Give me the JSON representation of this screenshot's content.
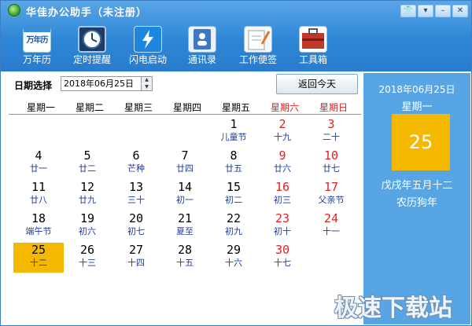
{
  "window": {
    "title": "华佳办公助手（未注册）",
    "controls": [
      "shirt-icon",
      "menu-icon",
      "minimize-icon",
      "close-icon"
    ]
  },
  "toolbar": {
    "items": [
      {
        "label": "万年历",
        "icon": "calendar-icon",
        "icon_text": "万年历"
      },
      {
        "label": "定时提醒",
        "icon": "clock-icon"
      },
      {
        "label": "闪电启动",
        "icon": "lightning-icon"
      },
      {
        "label": "通讯录",
        "icon": "contacts-icon"
      },
      {
        "label": "工作便签",
        "icon": "notes-icon"
      },
      {
        "label": "工具箱",
        "icon": "toolbox-icon"
      }
    ]
  },
  "datebar": {
    "label": "日期选择",
    "value": "2018年06月25日",
    "today_button": "返回今天"
  },
  "weekdays": [
    "星期一",
    "星期二",
    "星期三",
    "星期四",
    "星期五",
    "星期六",
    "星期日"
  ],
  "calendar": {
    "weeks": [
      [
        null,
        null,
        null,
        null,
        {
          "d": "1",
          "l": "儿童节"
        },
        {
          "d": "2",
          "l": "十九"
        },
        {
          "d": "3",
          "l": "二十"
        }
      ],
      [
        {
          "d": "4",
          "l": "廿一"
        },
        {
          "d": "5",
          "l": "廿二"
        },
        {
          "d": "6",
          "l": "芒种"
        },
        {
          "d": "7",
          "l": "廿四"
        },
        {
          "d": "8",
          "l": "廿五"
        },
        {
          "d": "9",
          "l": "廿六"
        },
        {
          "d": "10",
          "l": "廿七"
        }
      ],
      [
        {
          "d": "11",
          "l": "廿八"
        },
        {
          "d": "12",
          "l": "廿九"
        },
        {
          "d": "13",
          "l": "三十"
        },
        {
          "d": "14",
          "l": "初一"
        },
        {
          "d": "15",
          "l": "初二"
        },
        {
          "d": "16",
          "l": "初三"
        },
        {
          "d": "17",
          "l": "父亲节"
        }
      ],
      [
        {
          "d": "18",
          "l": "端午节"
        },
        {
          "d": "19",
          "l": "初六"
        },
        {
          "d": "20",
          "l": "初七"
        },
        {
          "d": "21",
          "l": "夏至"
        },
        {
          "d": "22",
          "l": "初九"
        },
        {
          "d": "23",
          "l": "初十"
        },
        {
          "d": "24",
          "l": "十一"
        }
      ],
      [
        {
          "d": "25",
          "l": "十二",
          "selected": true
        },
        {
          "d": "26",
          "l": "十三"
        },
        {
          "d": "27",
          "l": "十四"
        },
        {
          "d": "28",
          "l": "十五"
        },
        {
          "d": "29",
          "l": "十六"
        },
        {
          "d": "30",
          "l": "十七"
        },
        null
      ]
    ]
  },
  "side": {
    "date": "2018年06月25日",
    "weekday": "星期一",
    "day": "25",
    "ganzhi": "戊戌年五月十二",
    "lunar_year": "农历狗年"
  },
  "watermark": "极速下载站",
  "colors": {
    "accent": "#2e86d7",
    "side_panel": "#58a5e6",
    "highlight": "#f5b800",
    "weekend_red": "#dd2222",
    "lunar_blue": "#1c3aa0"
  }
}
